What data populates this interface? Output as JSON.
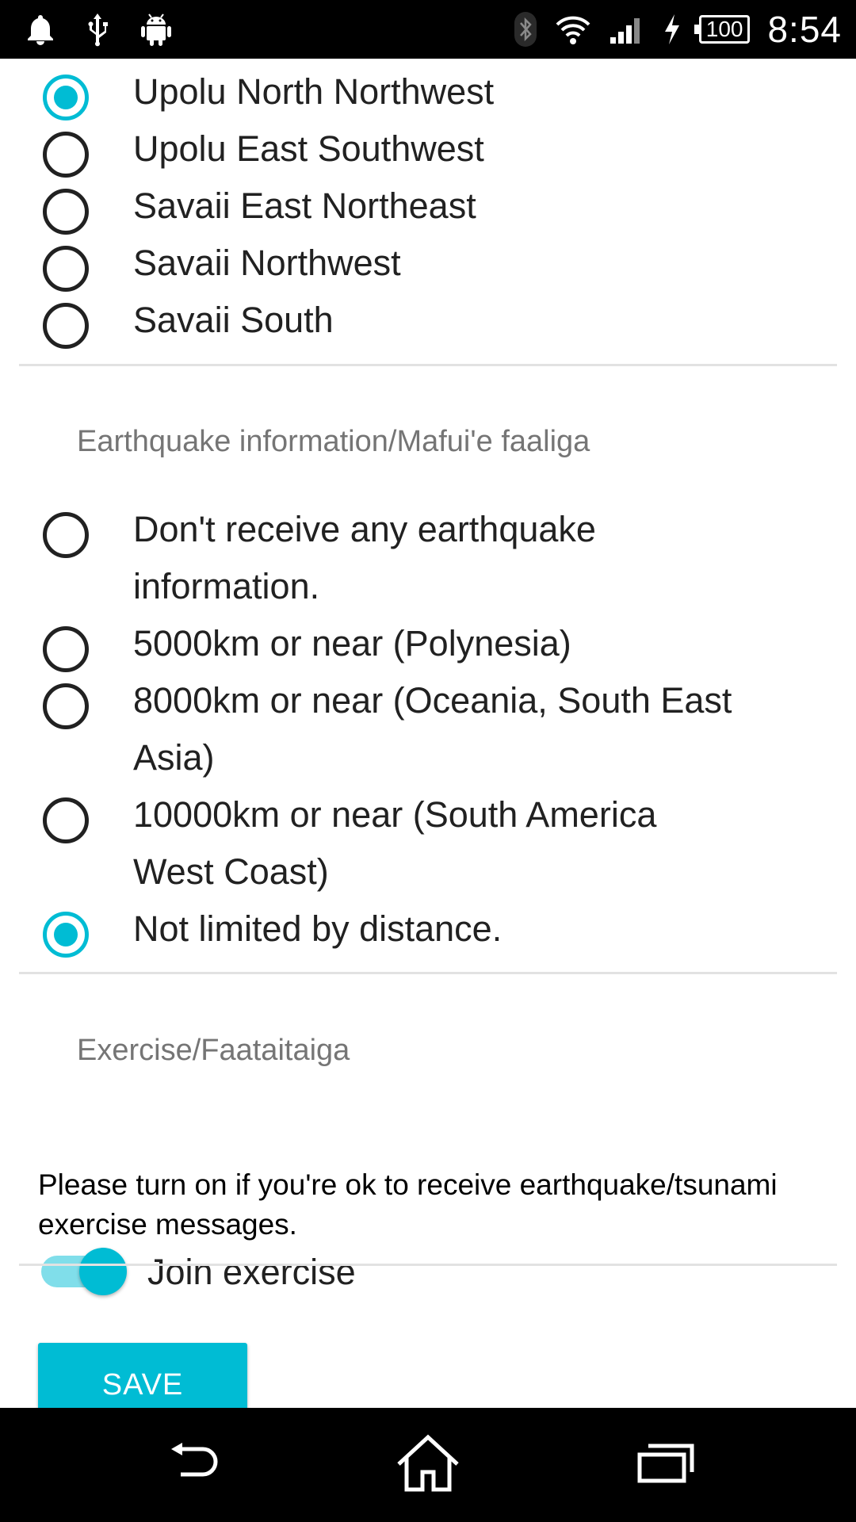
{
  "status_bar": {
    "time": "8:54",
    "battery": "100",
    "icons": [
      "notification-bell-icon",
      "usb-icon",
      "android-debug-icon",
      "bluetooth-icon",
      "wifi-icon",
      "signal-icon",
      "charging-icon"
    ]
  },
  "region_options": [
    {
      "label": "Upolu North Northwest",
      "checked": true
    },
    {
      "label": "Upolu East Southwest",
      "checked": false
    },
    {
      "label": "Savaii East Northeast",
      "checked": false
    },
    {
      "label": "Savaii Northwest",
      "checked": false
    },
    {
      "label": "Savaii South",
      "checked": false
    }
  ],
  "earthquake_section": {
    "title": "Earthquake information/Mafui'e faaliga",
    "options": [
      {
        "label": "Don't receive any earthquake information.",
        "checked": false
      },
      {
        "label": "5000km or near (Polynesia)",
        "checked": false
      },
      {
        "label": "8000km or near (Oceania, South East Asia)",
        "checked": false
      },
      {
        "label": "10000km or near (South America West Coast)",
        "checked": false
      },
      {
        "label": "Not limited by distance.",
        "checked": true
      }
    ]
  },
  "exercise_section": {
    "title": "Exercise/Faataitaiga",
    "description": "Please turn on if you're ok to receive earthquake/tsunami exercise messages.",
    "switch_label": "Join exercise",
    "switch_on": true
  },
  "save_button": "SAVE",
  "colors": {
    "accent": "#00bcd4",
    "accent_light": "#80deea",
    "text": "#212121",
    "secondary_text": "#757575"
  }
}
